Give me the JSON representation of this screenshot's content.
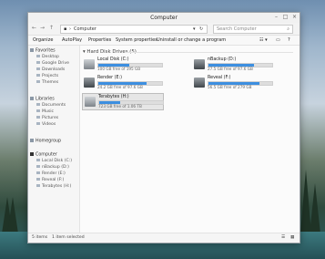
{
  "window": {
    "title": "Computer"
  },
  "nav": {
    "address": "Computer",
    "search_placeholder": "Search Computer"
  },
  "toolbar": {
    "items": [
      "Organize",
      "AutoPlay",
      "Properties",
      "System properties",
      "Uninstall or change a program"
    ]
  },
  "sidebar": {
    "favorites_label": "Favorites",
    "favorites": [
      "Desktop",
      "Google Drive",
      "Downloads",
      "Projects",
      "Themes"
    ],
    "libraries_label": "Libraries",
    "libraries": [
      "Documents",
      "Music",
      "Pictures",
      "Videos"
    ],
    "homegroup_label": "Homegroup",
    "computer_label": "Computer",
    "computer": [
      "Local Disk (C:)",
      "nBackup (D:)",
      "Render (E:)",
      "Reveal (F:)",
      "Terabytes (H:)"
    ]
  },
  "main": {
    "section_title": "Hard Disk Drives (5)",
    "drives": [
      {
        "name": "Local Disk (C:)",
        "free": "100 GB free of 195 GB",
        "fraction_used": 0.49,
        "selected": false
      },
      {
        "name": "nBackup (D:)",
        "free": "27.5 GB free of 97.6 GB",
        "fraction_used": 0.72,
        "selected": false
      },
      {
        "name": "Render (E:)",
        "free": "24.2 GB free of 97.6 GB",
        "fraction_used": 0.75,
        "selected": false
      },
      {
        "name": "Reveal (F:)",
        "free": "56.5 GB free of 279 GB",
        "fraction_used": 0.8,
        "selected": false
      },
      {
        "name": "Terabytes (H:)",
        "free": "723 GB free of 1.06 TB",
        "fraction_used": 0.33,
        "selected": true
      }
    ]
  },
  "status": {
    "count": "5 items",
    "selected": "1 item selected"
  },
  "colors": {
    "accent": "#3d8fe0"
  }
}
